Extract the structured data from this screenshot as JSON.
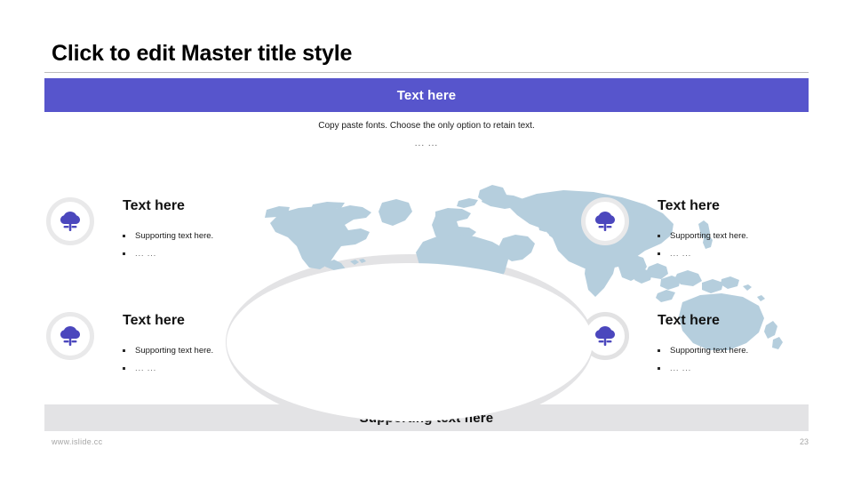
{
  "slide": {
    "master_title": "Click to edit Master title style",
    "accent_color": "#5755cc",
    "map_color": "#b5cedd",
    "ring_color": "#e3e3e5"
  },
  "banner": {
    "label": "Text here"
  },
  "subtitle": {
    "line1": "Copy paste fonts. Choose the only option to retain text.",
    "line2": "... ..."
  },
  "quadrants": [
    {
      "icon": "tree-icon",
      "heading": "Text here",
      "bullets": [
        "Supporting text here.",
        "... ..."
      ]
    },
    {
      "icon": "tree-icon",
      "heading": "Text here",
      "bullets": [
        "Supporting text here.",
        "... ..."
      ]
    },
    {
      "icon": "tree-icon",
      "heading": "Text here",
      "bullets": [
        "Supporting text here.",
        "... ..."
      ]
    },
    {
      "icon": "tree-icon",
      "heading": "Text here",
      "bullets": [
        "Supporting text here.",
        "... ..."
      ]
    }
  ],
  "bottom_bar": {
    "label": "Supporting text here"
  },
  "footer": {
    "url": "www.islide.cc",
    "page_number": "23"
  }
}
